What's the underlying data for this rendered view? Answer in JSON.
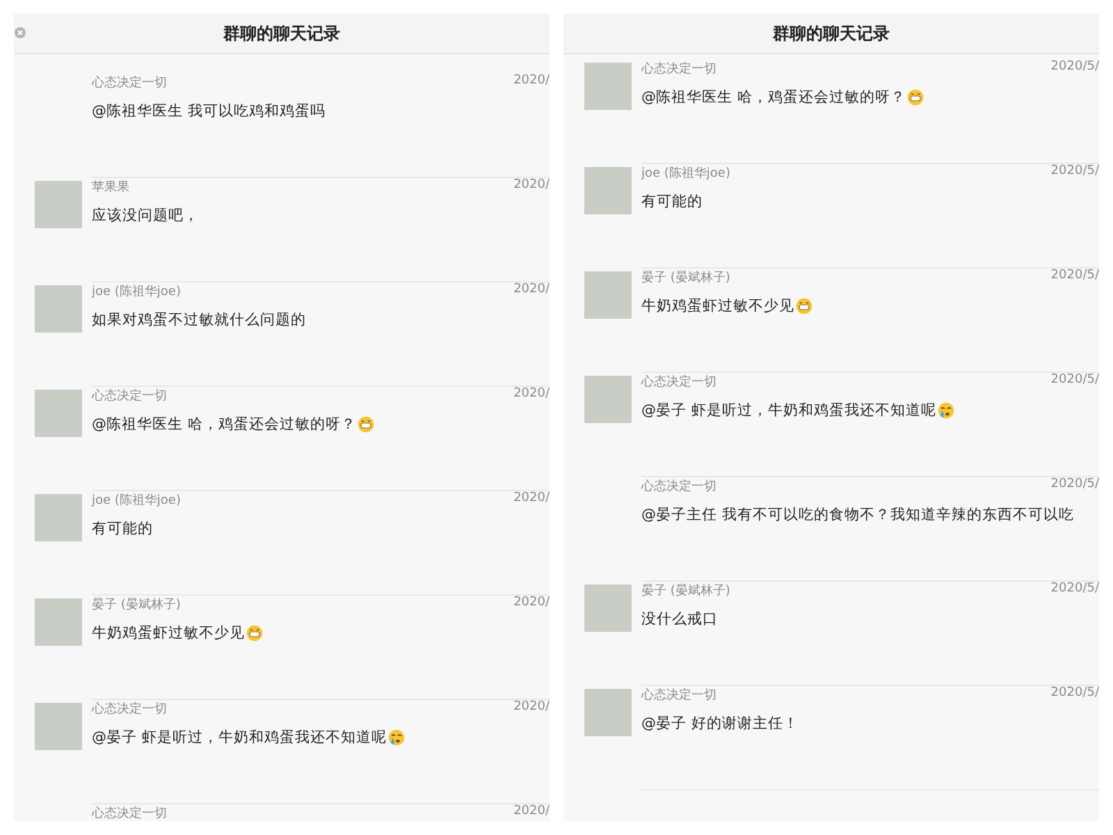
{
  "panels": [
    {
      "title": "群聊的聊天记录",
      "header_icon": true,
      "messages": [
        {
          "sender": "心态决定一切",
          "time": "2020/",
          "text": "@陈祖华医生 我可以吃鸡和鸡蛋吗",
          "kind": "plain",
          "avatar": false
        },
        {
          "sender": "苹果果",
          "time": "2020/",
          "text": "应该没问题吧，",
          "kind": "plain",
          "avatar": true
        },
        {
          "sender": "joe (陈祖华joe)",
          "time": "2020/",
          "text": "如果对鸡蛋不过敏就什么问题的",
          "kind": "plain",
          "avatar": true
        },
        {
          "sender": "心态决定一切",
          "time": "2020/",
          "text": "@陈祖华医生 哈，鸡蛋还会过敏的呀？",
          "kind": "grin",
          "avatar": true
        },
        {
          "sender": "joe (陈祖华joe)",
          "time": "2020/",
          "text": "有可能的",
          "kind": "plain",
          "avatar": true
        },
        {
          "sender": "晏子 (晏斌林子)",
          "time": "2020/",
          "text": "牛奶鸡蛋虾过敏不少见",
          "kind": "grin",
          "avatar": true
        },
        {
          "sender": "心态决定一切",
          "time": "2020/",
          "text": "@晏子 虾是听过，牛奶和鸡蛋我还不知道呢",
          "kind": "cry",
          "avatar": true
        },
        {
          "sender": "心态决定一切",
          "time": "2020/",
          "avatar": false
        }
      ]
    },
    {
      "title": "群聊的聊天记录",
      "header_icon": false,
      "messages": [
        {
          "sender": "心态决定一切",
          "time": "2020/5/",
          "text": "@陈祖华医生 哈，鸡蛋还会过敏的呀？",
          "kind": "grin",
          "avatar": true
        },
        {
          "sender": "joe (陈祖华joe)",
          "time": "2020/5/",
          "text": "有可能的",
          "kind": "plain",
          "avatar": true
        },
        {
          "sender": "晏子 (晏斌林子)",
          "time": "2020/5/",
          "text": "牛奶鸡蛋虾过敏不少见",
          "kind": "grin",
          "avatar": true
        },
        {
          "sender": "心态决定一切",
          "time": "2020/5/",
          "text": "@晏子 虾是听过，牛奶和鸡蛋我还不知道呢",
          "kind": "cry",
          "avatar": true
        },
        {
          "sender": "心态决定一切",
          "time": "2020/5/",
          "text": "@晏子主任 我有不可以吃的食物不？我知道辛辣的东西不可以吃",
          "kind": "plain",
          "avatar": false
        },
        {
          "sender": "晏子 (晏斌林子)",
          "time": "2020/5/",
          "text": "没什么戒口",
          "kind": "plain",
          "avatar": true
        },
        {
          "sender": "心态决定一切",
          "time": "2020/5/",
          "text": "@晏子 好的谢谢主任！",
          "kind": "plain",
          "avatar": true
        }
      ]
    }
  ]
}
